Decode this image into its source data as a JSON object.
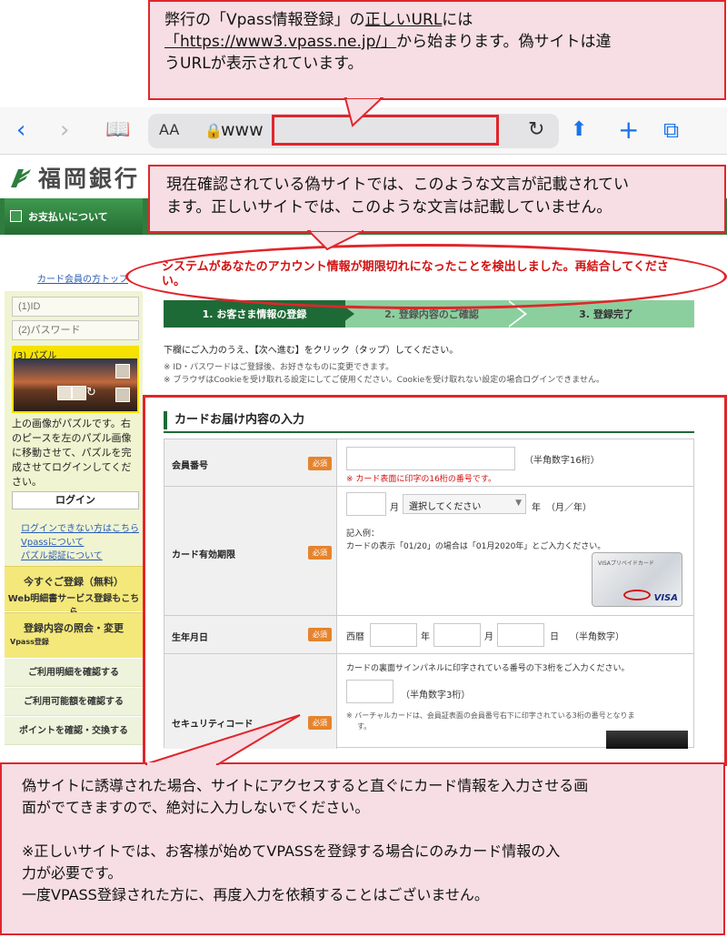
{
  "browser": {
    "back_icon": "chevron-left-icon",
    "url_text": "www",
    "aa_label": "AA",
    "icons": [
      "chevron-left-icon",
      "chevron-right-icon",
      "book-icon",
      "lock-icon",
      "reload-icon",
      "share-icon",
      "plus-icon",
      "tabs-icon"
    ]
  },
  "bank": {
    "logo_text": "福岡銀行",
    "nav_pay": "お支払いについて"
  },
  "sidebar": {
    "top_link": "カード会員の方トップ",
    "id_placeholder": "(1)ID",
    "password_placeholder": "(2)パスワード",
    "puzzle_label": "(3) パズル",
    "description": "上の画像がパズルです。右のピースを左のパズル画像に移動させて、パズルを完成させてログインしてください。",
    "login_button": "ログイン",
    "links": [
      "ログインできない方はこちら",
      "Vpassについて",
      "パズル認証について"
    ],
    "register_title": "今すぐご登録（無料）",
    "register_sub": "Web明細書サービス登録もこちら",
    "inquiry_title": "登録内容の照会・変更",
    "inquiry_sub": "Vpass登録",
    "menu": [
      "ご利用明細を確認する",
      "ご利用可能額を確認する",
      "ポイントを確認・交換する"
    ]
  },
  "main": {
    "error_message": "システムがあなたのアカウント情報が期限切れになったことを検出しました。再結合してください。",
    "steps": [
      "1. お客さま情報の登録",
      "2. 登録内容のご確認",
      "3. 登録完了"
    ],
    "instruction": "下欄にご入力のうえ、【次へ進む】をクリック（タップ）してください。",
    "notes": [
      "※ ID・パスワードはご登録後、お好きなものに変更できます。",
      "※ ブラウザはCookieを受け取れる設定にしてご使用ください。Cookieを受け取れない設定の場合ログインできません。"
    ]
  },
  "form": {
    "section_title": "カードお届け内容の入力",
    "required": "必須",
    "card_number_label": "会員番号",
    "card_number_hint": "（半角数字16桁）",
    "card_number_note": "※ カード表面に印字の16桁の番号です。",
    "expiry_label": "カード有効期限",
    "month_unit": "月",
    "select_placeholder": "選択してください",
    "year_unit": "年",
    "expiry_format": "（月／年）",
    "example_title": "記入例：",
    "example_text": "カードの表示「01/20」の場合は「01月2020年」とご入力ください。",
    "card_brand": "VISAプリペイドカード",
    "card_logo": "VISA",
    "birth_label": "生年月日",
    "era": "西暦",
    "birth_year_unit": "年",
    "birth_month_unit": "月",
    "birth_day_unit": "日",
    "birth_hint": "（半角数字）",
    "security_label": "セキュリティコード",
    "security_intro": "カードの裏面サインパネルに印字されている番号の下3桁をご入力ください。",
    "security_hint": "（半角数字3桁）",
    "security_note_1": "※ バーチャルカードは、会員証表面の会員番号右下に印字されている3桁の番号となりま",
    "security_note_2": "す。"
  },
  "callouts": {
    "top_l1a": "弊行の「Vpass情報登録」の",
    "top_l1b": "正しいURL",
    "top_l1c": "には",
    "top_l2a": "「https://www3.vpass.ne.jp/」",
    "top_l2b": "から始まります。偽サイトは違",
    "top_l3": "うURLが表示されています。",
    "mid_l1": "現在確認されている偽サイトでは、このような文言が記載されてい",
    "mid_l2": "ます。正しいサイトでは、このような文言は記載していません。",
    "bottom_l1": "偽サイトに誘導された場合、サイトにアクセスすると直ぐにカード情報を入力させる画",
    "bottom_l2": "面がでてきますので、絶対に入力しないでください。",
    "bottom_l3": "※正しいサイトでは、お客様が始めてVPASSを登録する場合にのみカード情報の入",
    "bottom_l4": "力が必要です。",
    "bottom_l5": "一度VPASS登録された方に、再度入力を依頼することはございません。"
  }
}
